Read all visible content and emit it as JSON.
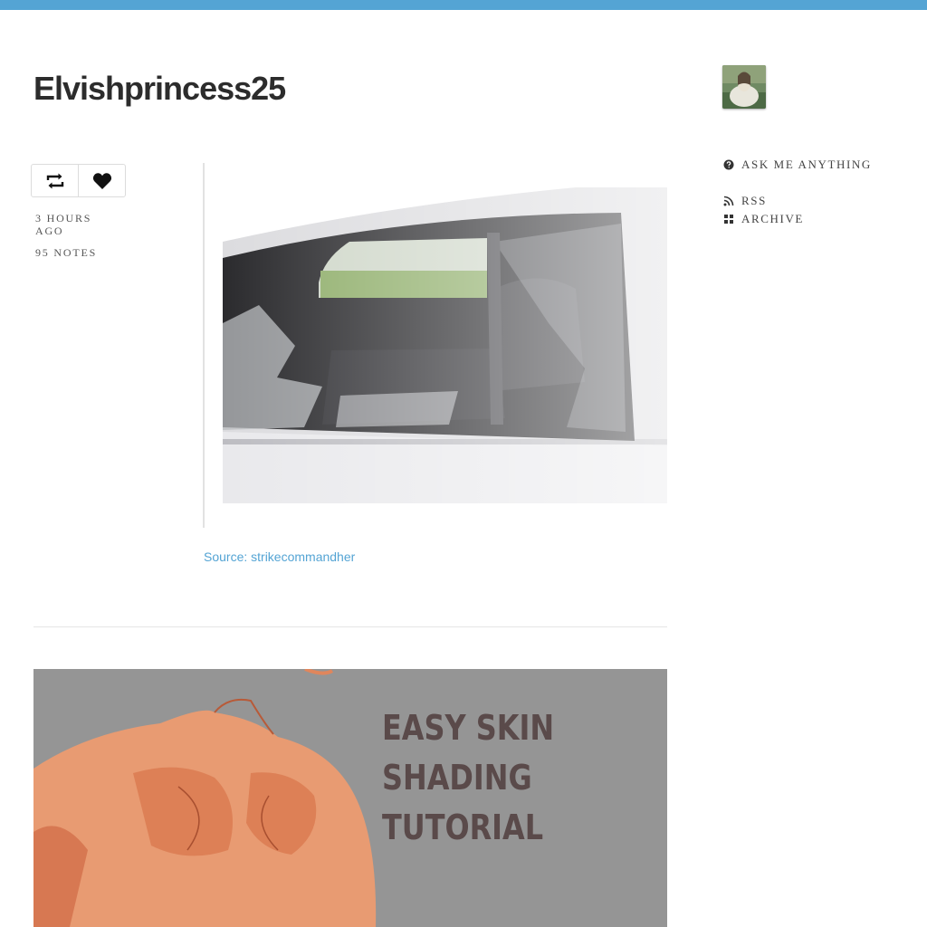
{
  "blog": {
    "title": "Elvishprincess25"
  },
  "sidebar": {
    "ask_label": "ASK ME ANYTHING",
    "rss_label": "RSS",
    "archive_label": "ARCHIVE"
  },
  "post1": {
    "time_ago": "3 HOURS AGO",
    "notes": "95 NOTES",
    "source_label": "Source: strikecommandher",
    "icons": [
      "reblog-icon",
      "heart-icon"
    ]
  },
  "post2": {
    "image_text": "EASY SKIN\nSHADING\nTUTORIAL"
  },
  "colors": {
    "accent": "#54a4d4",
    "text": "#2c2c2c",
    "divider": "#e5e5e5"
  }
}
